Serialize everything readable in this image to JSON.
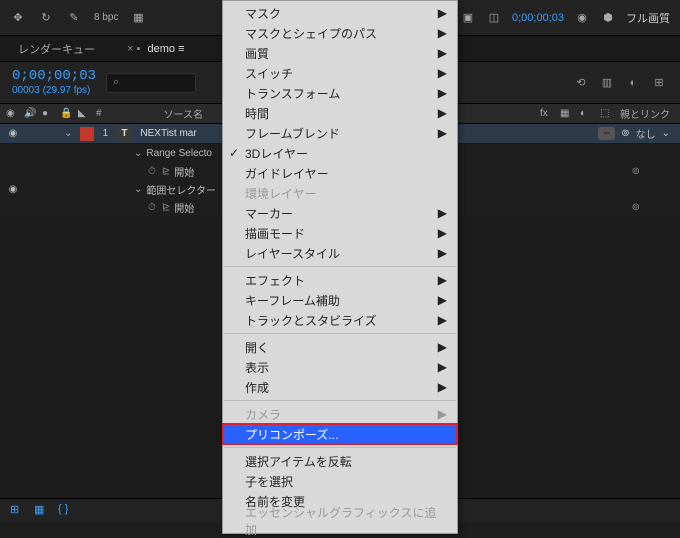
{
  "toolbar": {
    "bpc": "8 bpc",
    "timecode": "0;00;00;03",
    "quality": "フル画質"
  },
  "tabs": {
    "left": "レンダーキュー",
    "active": "demo"
  },
  "comp": {
    "timecode": "0;00;00;03",
    "fps": "00003 (29.97 fps)",
    "search_placeholder": ""
  },
  "columns": {
    "hash": "#",
    "source_name": "ソース名",
    "parent": "親とリンク",
    "none": "なし"
  },
  "layer": {
    "index": "1",
    "type_glyph": "T",
    "name": "NEXTist mar",
    "range_selector": "Range Selecto",
    "start1": "開始",
    "range_selector_jp": "範囲セレクター",
    "start2": "開始"
  },
  "menu": {
    "mask": "マスク",
    "mask_shape_path": "マスクとシェイプのパス",
    "quality": "画質",
    "switch": "スイッチ",
    "transform": "トランスフォーム",
    "time": "時間",
    "frame_blend": "フレームブレンド",
    "3d_layer": "3Dレイヤー",
    "guide_layer": "ガイドレイヤー",
    "env_layer": "環境レイヤー",
    "marker": "マーカー",
    "paint_mode": "描画モード",
    "layer_style": "レイヤースタイル",
    "effect": "エフェクト",
    "kf_assist": "キーフレーム補助",
    "track_stab": "トラックとスタビライズ",
    "open": "開く",
    "view": "表示",
    "create": "作成",
    "camera": "カメラ",
    "precompose": "プリコンポーズ...",
    "invert_sel": "選択アイテムを反転",
    "select_children": "子を選択",
    "rename": "名前を変更",
    "essential_graphics": "エッセンシャルグラフィックスに追加"
  }
}
